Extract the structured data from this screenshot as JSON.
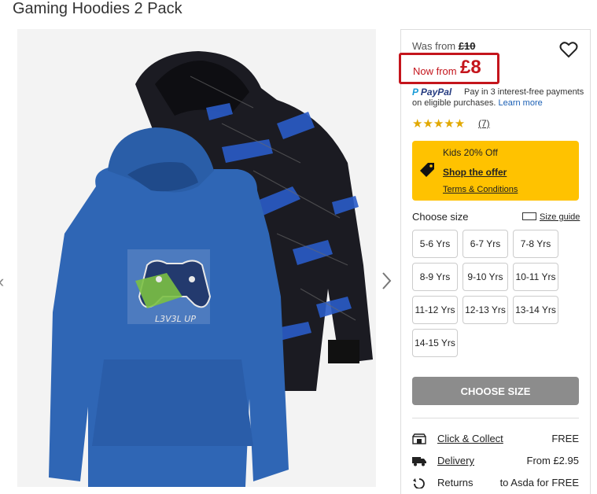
{
  "product": {
    "title": "Gaming Hoodies 2 Pack",
    "was_label": "Was from",
    "was_price": "£10",
    "now_label": "Now from",
    "now_price": "£8",
    "rating_stars": 5,
    "stars_text": "★★★★★",
    "review_count": "(7)"
  },
  "paypal": {
    "logo_prefix": "P",
    "logo_text": "PayPal",
    "line1": "Pay in 3 interest-free payments",
    "line2": "on eligible purchases.",
    "learn_more": "Learn more"
  },
  "promo": {
    "title": "Kids 20% Off",
    "link": "Shop the offer",
    "terms": "Terms & Conditions",
    "icon": "tag-icon",
    "color": "#ffc200"
  },
  "sizes": {
    "heading": "Choose size",
    "guide": "Size guide",
    "options": [
      "5-6 Yrs",
      "6-7 Yrs",
      "7-8 Yrs",
      "8-9 Yrs",
      "9-10 Yrs",
      "10-11 Yrs",
      "11-12 Yrs",
      "12-13 Yrs",
      "13-14 Yrs",
      "14-15 Yrs"
    ]
  },
  "cta": {
    "label": "CHOOSE SIZE"
  },
  "delivery": [
    {
      "icon": "store-icon",
      "label": "Click & Collect",
      "value": "FREE"
    },
    {
      "icon": "truck-icon",
      "label": "Delivery",
      "value": "From £2.95"
    },
    {
      "icon": "return-icon",
      "label": "Returns",
      "value": "to Asda for FREE"
    }
  ],
  "colors": {
    "sale_red": "#c4151c",
    "star_gold": "#e1a800",
    "button_grey": "#8c8c8c"
  }
}
